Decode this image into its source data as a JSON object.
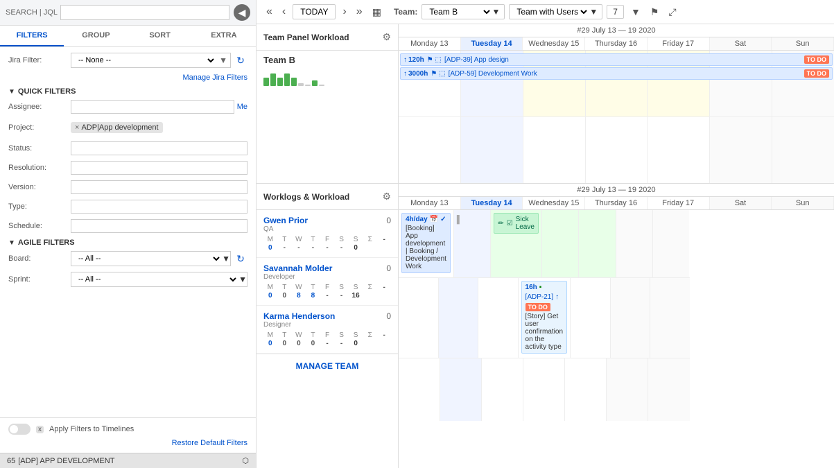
{
  "search": {
    "placeholder": "SEARCH | JQL",
    "value": ""
  },
  "filters": {
    "tabs": [
      "FILTERS",
      "GROUP",
      "SORT",
      "EXTRA"
    ],
    "active_tab": "FILTERS",
    "jira_filter": {
      "label": "Jira Filter:",
      "value": "-- None --"
    },
    "manage_link": "Manage Jira Filters",
    "quick_filters_header": "QUICK FILTERS",
    "fields": {
      "assignee": {
        "label": "Assignee:",
        "value": "",
        "me_label": "Me"
      },
      "project": {
        "label": "Project:",
        "tags": [
          {
            "remove": "×",
            "board": "ADP",
            "name": "App development"
          }
        ]
      },
      "status": {
        "label": "Status:",
        "value": ""
      },
      "resolution": {
        "label": "Resolution:",
        "value": ""
      },
      "version": {
        "label": "Version:",
        "value": ""
      },
      "type": {
        "label": "Type:",
        "value": ""
      },
      "schedule": {
        "label": "Schedule:",
        "value": ""
      }
    },
    "agile_header": "AGILE FILTERS",
    "board": {
      "label": "Board:",
      "value": "-- All --"
    },
    "sprint": {
      "label": "Sprint:",
      "value": "-- All --"
    },
    "apply_filters_label": "Apply Filters to Timelines",
    "toggle_state": "off",
    "x_label": "x",
    "restore_link": "Restore Default Filters"
  },
  "bottom_status": {
    "count": "65",
    "project": "[ADP] APP DEVELOPMENT",
    "icon": "▲"
  },
  "toolbar": {
    "nav_prev_prev": "«",
    "nav_prev": "‹",
    "today": "TODAY",
    "nav_next": "›",
    "nav_next_next": "»",
    "calendar_icon": "▦",
    "team_label": "Team:",
    "team_value": "Team B",
    "view_value": "Team with Users",
    "num_value": "7",
    "flag_icon": "⚑",
    "expand_icon": "⤢"
  },
  "team_panel": {
    "title": "Team Panel Workload",
    "week_range": "#29 July 13 — 19 2020",
    "day_headers": [
      "Monday 13",
      "Tuesday 14",
      "Wednesday 15",
      "Thursday 16",
      "Friday 17",
      "Sat",
      "Sun"
    ],
    "today_index": 1,
    "team_name": "Team B",
    "bars": [
      3,
      5,
      3,
      5,
      3,
      1,
      0,
      2,
      0
    ],
    "tasks": [
      {
        "id": "ADP-39",
        "label": "App design",
        "hours": "120h",
        "status": "TO DO",
        "color": "blue",
        "col_start": 0,
        "col_span": 7
      },
      {
        "id": "ADP-59",
        "label": "Development Work",
        "hours": "3000h",
        "status": "TO DO",
        "color": "blue",
        "col_start": 0,
        "col_span": 7
      }
    ]
  },
  "worklogs_panel": {
    "title": "Worklogs & Workload",
    "week_range": "#29 July 13 — 19 2020",
    "day_headers": [
      "Monday 13",
      "Tuesday 14",
      "Wednesday 15",
      "Thursday 16",
      "Friday 17",
      "Sat",
      "Sun"
    ],
    "today_index": 1,
    "workers": [
      {
        "name": "Gwen Prior",
        "role": "QA",
        "logged": "0",
        "days_labels": [
          "M",
          "T",
          "W",
          "T",
          "F",
          "S",
          "S",
          "Σ"
        ],
        "days_values": [
          "-",
          "0",
          "-",
          "-",
          "-",
          "-",
          "-",
          "0"
        ],
        "worklog_entries": [
          {
            "day_index": 0,
            "hours": "4h/day",
            "title": "[Booking] App development | Booking / Development Work",
            "has_calendar": true,
            "has_check": true
          }
        ],
        "sick_entries": [
          {
            "day_index": 2,
            "label": "Sick Leave"
          }
        ]
      },
      {
        "name": "Savannah Molder",
        "role": "Developer",
        "logged": "0",
        "days_labels": [
          "M",
          "T",
          "W",
          "T",
          "F",
          "S",
          "S",
          "Σ"
        ],
        "days_values": [
          "-",
          "0",
          "0",
          "8",
          "8",
          "-",
          "-",
          "16"
        ],
        "story_entries": [
          {
            "day_index": 3,
            "hours": "16h",
            "id": "ADP-21",
            "title": "[Story] Get user confirmation on the activity type",
            "status": "TO DO",
            "has_arrow": true
          }
        ]
      },
      {
        "name": "Karma Henderson",
        "role": "Designer",
        "logged": "0",
        "days_labels": [
          "M",
          "T",
          "W",
          "T",
          "F",
          "S",
          "S",
          "Σ"
        ],
        "days_values": [
          "-",
          "0",
          "0",
          "0",
          "0",
          "-",
          "-",
          "0"
        ]
      }
    ],
    "manage_team_label": "MANAGE TEAM"
  },
  "colors": {
    "accent_blue": "#0052cc",
    "today_bg": "#f0f4ff",
    "today_header": "#e8f0fe",
    "green_bar": "#4caf50",
    "task_blue_bg": "#deebff",
    "task_blue_border": "#b3d0ff",
    "sick_bg": "#c8f5d4",
    "sick_border": "#99e6b3",
    "todo_bg": "#ff7452"
  }
}
